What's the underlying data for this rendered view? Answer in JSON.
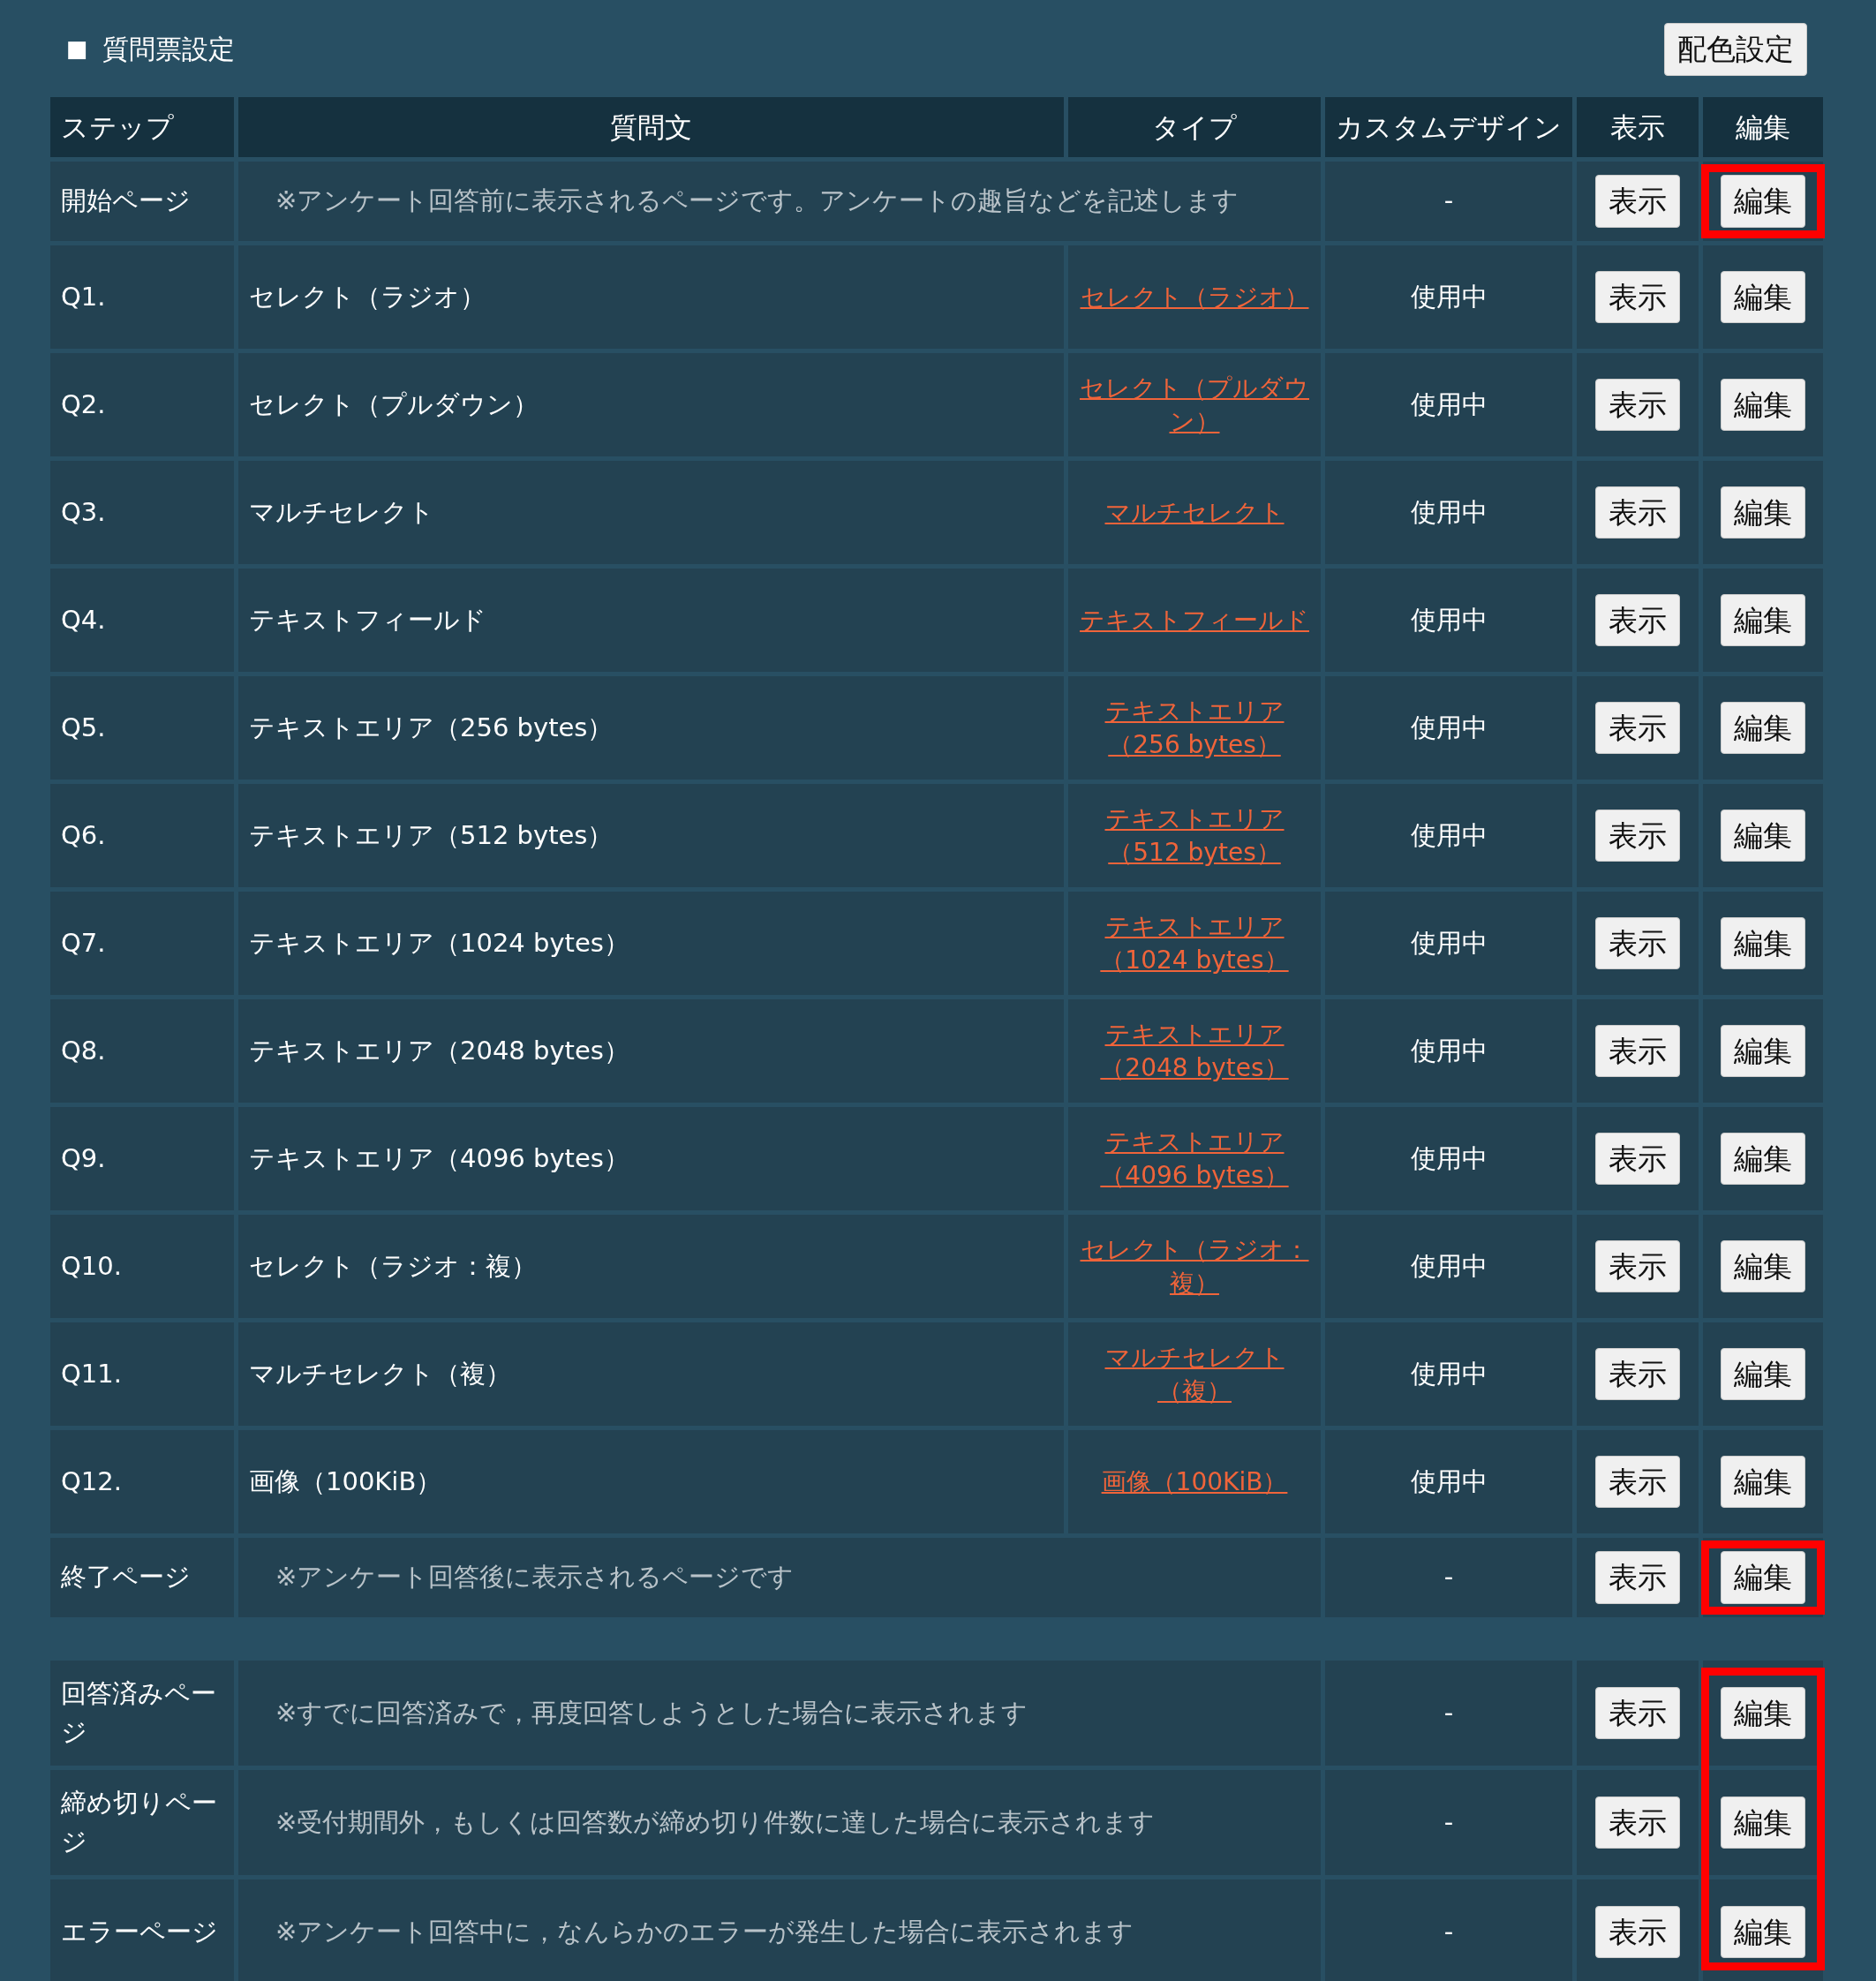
{
  "heading": {
    "bullet": "■",
    "text": "質問票設定"
  },
  "color_button": "配色設定",
  "columns": [
    "ステップ",
    "質問文",
    "タイプ",
    "カスタムデザイン",
    "表示",
    "編集"
  ],
  "rows": [
    {
      "kind": "page",
      "step": "開始ページ",
      "note": "※アンケート回答前に表示されるページです。アンケートの趣旨などを記述します",
      "custom": "-",
      "show": "表示",
      "edit": "編集",
      "highlighted": true
    },
    {
      "kind": "question",
      "step": "Q1.",
      "question": "セレクト（ラジオ）",
      "type": "セレクト（ラジオ）",
      "custom": "使用中",
      "show": "表示",
      "edit": "編集",
      "highlighted": false
    },
    {
      "kind": "question",
      "step": "Q2.",
      "question": "セレクト（プルダウン）",
      "type": "セレクト（プルダウン）",
      "custom": "使用中",
      "show": "表示",
      "edit": "編集",
      "highlighted": false
    },
    {
      "kind": "question",
      "step": "Q3.",
      "question": "マルチセレクト",
      "type": "マルチセレクト",
      "custom": "使用中",
      "show": "表示",
      "edit": "編集",
      "highlighted": false
    },
    {
      "kind": "question",
      "step": "Q4.",
      "question": "テキストフィールド",
      "type": "テキストフィールド",
      "custom": "使用中",
      "show": "表示",
      "edit": "編集",
      "highlighted": false
    },
    {
      "kind": "question",
      "step": "Q5.",
      "question": "テキストエリア（256 bytes）",
      "type": "テキストエリア（256 bytes）",
      "custom": "使用中",
      "show": "表示",
      "edit": "編集",
      "highlighted": false
    },
    {
      "kind": "question",
      "step": "Q6.",
      "question": "テキストエリア（512 bytes）",
      "type": "テキストエリア（512 bytes）",
      "custom": "使用中",
      "show": "表示",
      "edit": "編集",
      "highlighted": false
    },
    {
      "kind": "question",
      "step": "Q7.",
      "question": "テキストエリア（1024 bytes）",
      "type": "テキストエリア（1024 bytes）",
      "custom": "使用中",
      "show": "表示",
      "edit": "編集",
      "highlighted": false
    },
    {
      "kind": "question",
      "step": "Q8.",
      "question": "テキストエリア（2048 bytes）",
      "type": "テキストエリア（2048 bytes）",
      "custom": "使用中",
      "show": "表示",
      "edit": "編集",
      "highlighted": false
    },
    {
      "kind": "question",
      "step": "Q9.",
      "question": "テキストエリア（4096 bytes）",
      "type": "テキストエリア（4096 bytes）",
      "custom": "使用中",
      "show": "表示",
      "edit": "編集",
      "highlighted": false
    },
    {
      "kind": "question",
      "step": "Q10.",
      "question": "セレクト（ラジオ：複）",
      "type": "セレクト（ラジオ：複）",
      "custom": "使用中",
      "show": "表示",
      "edit": "編集",
      "highlighted": false
    },
    {
      "kind": "question",
      "step": "Q11.",
      "question": "マルチセレクト（複）",
      "type": "マルチセレクト（複）",
      "custom": "使用中",
      "show": "表示",
      "edit": "編集",
      "highlighted": false
    },
    {
      "kind": "question",
      "step": "Q12.",
      "question": "画像（100KiB）",
      "type": "画像（100KiB）",
      "custom": "使用中",
      "show": "表示",
      "edit": "編集",
      "highlighted": false
    },
    {
      "kind": "page",
      "step": "終了ページ",
      "note": "※アンケート回答後に表示されるページです",
      "custom": "-",
      "show": "表示",
      "edit": "編集",
      "highlighted": true
    }
  ],
  "extra_rows": [
    {
      "kind": "page",
      "step": "回答済みページ",
      "note": "※すでに回答済みで，再度回答しようとした場合に表示されます",
      "custom": "-",
      "show": "表示",
      "edit": "編集",
      "highlighted": true
    },
    {
      "kind": "page",
      "step": "締め切りページ",
      "note": "※受付期間外，もしくは回答数が締め切り件数に達した場合に表示されます",
      "custom": "-",
      "show": "表示",
      "edit": "編集",
      "highlighted": true
    },
    {
      "kind": "page",
      "step": "エラーページ",
      "note": "※アンケート回答中に，なんらかのエラーが発生した場合に表示されます",
      "custom": "-",
      "show": "表示",
      "edit": "編集",
      "highlighted": true
    }
  ]
}
